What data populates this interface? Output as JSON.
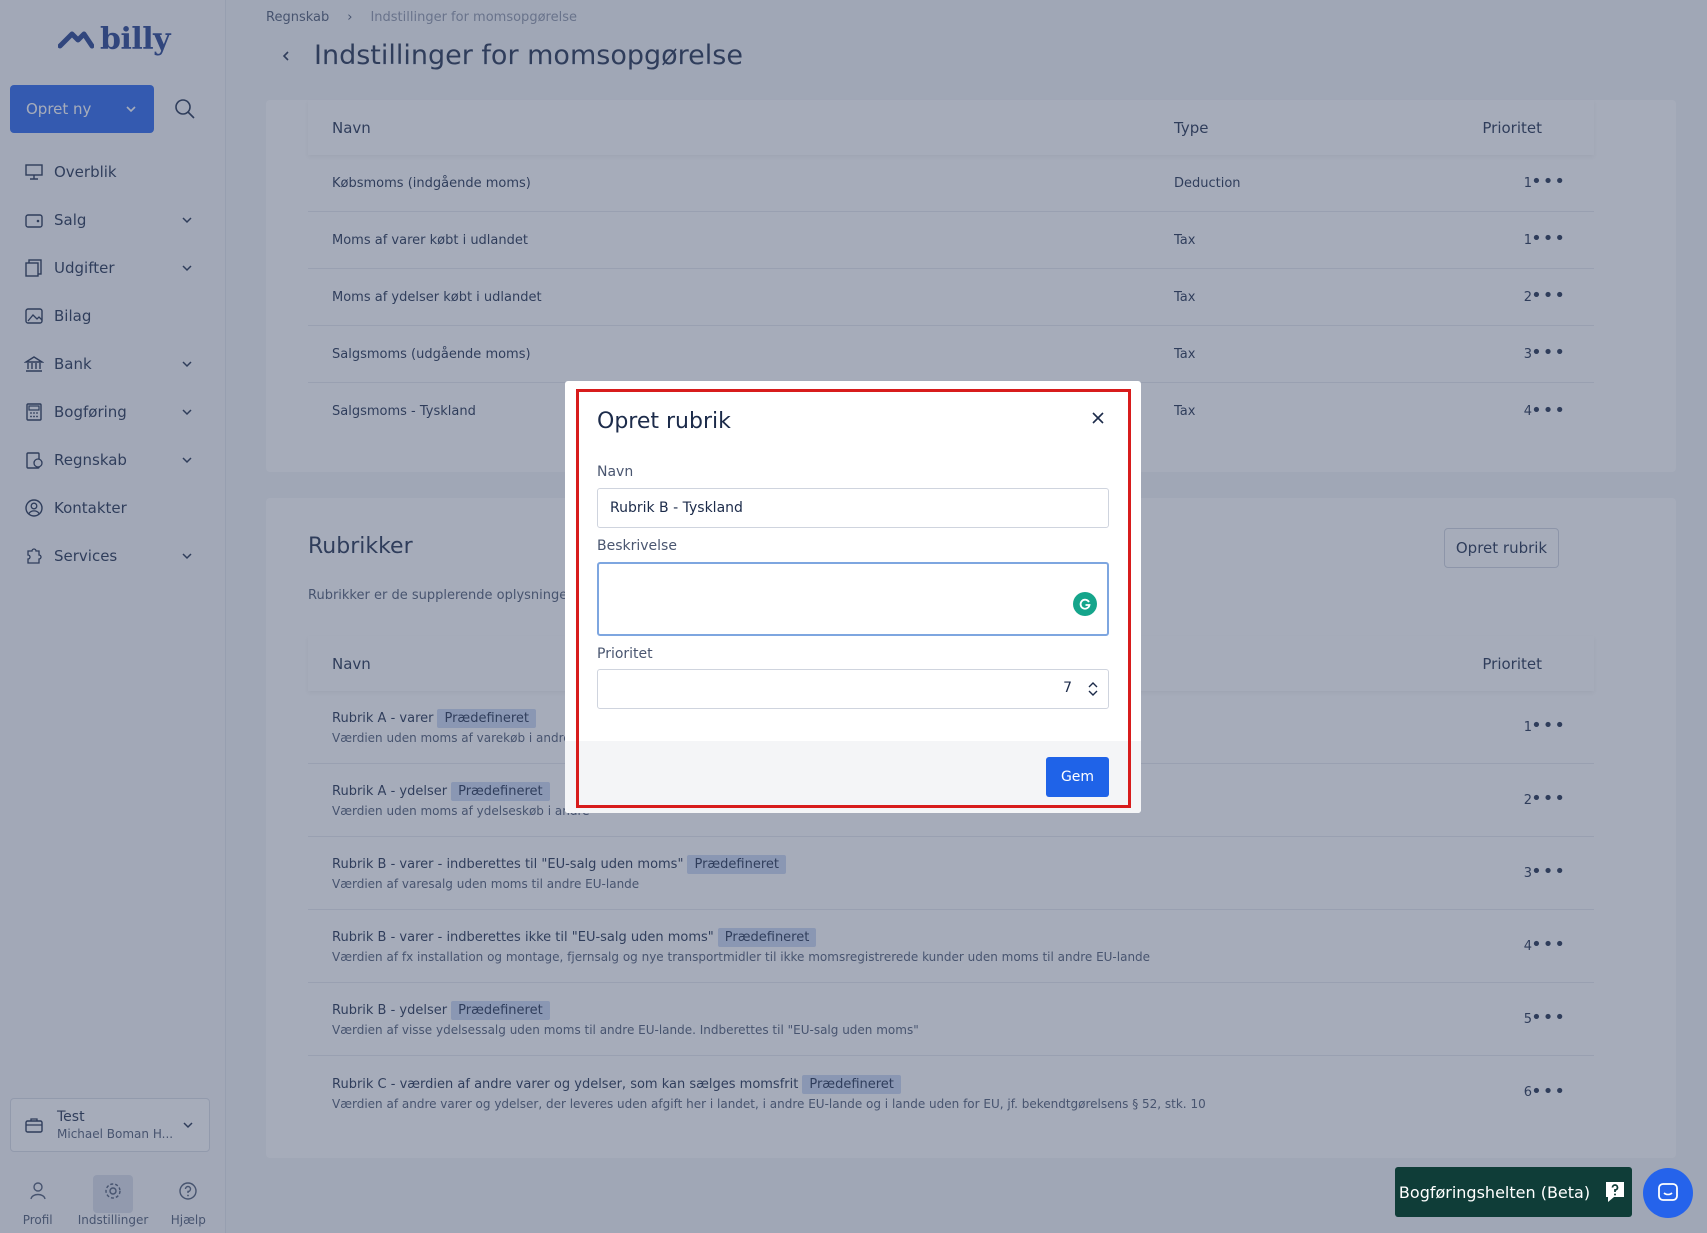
{
  "app": {
    "logo_text": "billy",
    "accent_color": "#2563eb"
  },
  "sidebar": {
    "create_button_label": "Opret ny",
    "items": [
      {
        "label": "Overblik",
        "icon": "presentation-board-icon",
        "expandable": false
      },
      {
        "label": "Salg",
        "icon": "wallet-icon",
        "expandable": true
      },
      {
        "label": "Udgifter",
        "icon": "receipt-copy-icon",
        "expandable": true
      },
      {
        "label": "Bilag",
        "icon": "image-document-icon",
        "expandable": false
      },
      {
        "label": "Bank",
        "icon": "bank-icon",
        "expandable": true
      },
      {
        "label": "Bogføring",
        "icon": "calculator-icon",
        "expandable": true
      },
      {
        "label": "Regnskab",
        "icon": "ledger-icon",
        "expandable": true
      },
      {
        "label": "Kontakter",
        "icon": "contact-icon",
        "expandable": false
      },
      {
        "label": "Services",
        "icon": "puzzle-icon",
        "expandable": true
      }
    ],
    "organization": {
      "name": "Test",
      "user": "Michael Boman H..."
    },
    "bottom_nav": [
      {
        "label": "Profil",
        "icon": "user-icon"
      },
      {
        "label": "Indstillinger",
        "icon": "gear-icon",
        "active": true
      },
      {
        "label": "Hjælp",
        "icon": "question-circle-icon"
      }
    ]
  },
  "breadcrumb": {
    "parent": "Regnskab",
    "current": "Indstillinger for momsopgørelse"
  },
  "page_title": "Indstillinger for momsopgørelse",
  "accounts_table": {
    "headers": {
      "name": "Navn",
      "type": "Type",
      "priority": "Prioritet"
    },
    "rows": [
      {
        "name": "Købsmoms (indgående moms)",
        "type": "Deduction",
        "priority": "1"
      },
      {
        "name": "Moms af varer købt i udlandet",
        "type": "Tax",
        "priority": "1"
      },
      {
        "name": "Moms af ydelser købt i udlandet",
        "type": "Tax",
        "priority": "2"
      },
      {
        "name": "Salgsmoms (udgående moms)",
        "type": "Tax",
        "priority": "3"
      },
      {
        "name": "Salgsmoms - Tyskland",
        "type": "Tax",
        "priority": "4"
      }
    ]
  },
  "rubrikker": {
    "title": "Rubrikker",
    "description": "Rubrikker er de supplerende oplysninger, so",
    "create_button": "Opret rubrik",
    "headers": {
      "name": "Navn",
      "priority": "Prioritet"
    },
    "badge_label": "Prædefineret",
    "rows": [
      {
        "name": "Rubrik A - varer",
        "desc": "Værdien uden moms af varekøb i andre EU",
        "priority": "1"
      },
      {
        "name": "Rubrik A - ydelser",
        "desc": "Værdien uden moms af ydelseskøb i andre",
        "priority": "2"
      },
      {
        "name": "Rubrik B - varer - indberettes til \"EU-salg uden moms\"",
        "desc": "Værdien af varesalg uden moms til andre EU-lande",
        "priority": "3"
      },
      {
        "name": "Rubrik B - varer - indberettes ikke til \"EU-salg uden moms\"",
        "desc": "Værdien af fx installation og montage, fjernsalg og nye transportmidler til ikke momsregistrerede kunder uden moms til andre EU-lande",
        "priority": "4"
      },
      {
        "name": "Rubrik B - ydelser",
        "desc": "Værdien af visse ydelsessalg uden moms til andre EU-lande. Indberettes til \"EU-salg uden moms\"",
        "priority": "5"
      },
      {
        "name": "Rubrik C - værdien af andre varer og ydelser, som kan sælges momsfrit",
        "desc": "Værdien af andre varer og ydelser, der leveres uden afgift her i landet, i andre EU-lande og i lande uden for EU, jf. bekendtgørelsens § 52, stk. 10",
        "priority": "6"
      }
    ]
  },
  "help_widget": {
    "label": "Bogføringshelten (Beta)"
  },
  "modal": {
    "title": "Opret rubrik",
    "name_label": "Navn",
    "name_value": "Rubrik B - Tyskland",
    "description_label": "Beskrivelse",
    "description_value": "",
    "priority_label": "Prioritet",
    "priority_value": "7",
    "save_label": "Gem",
    "highlight_color": "#d81c1c"
  }
}
